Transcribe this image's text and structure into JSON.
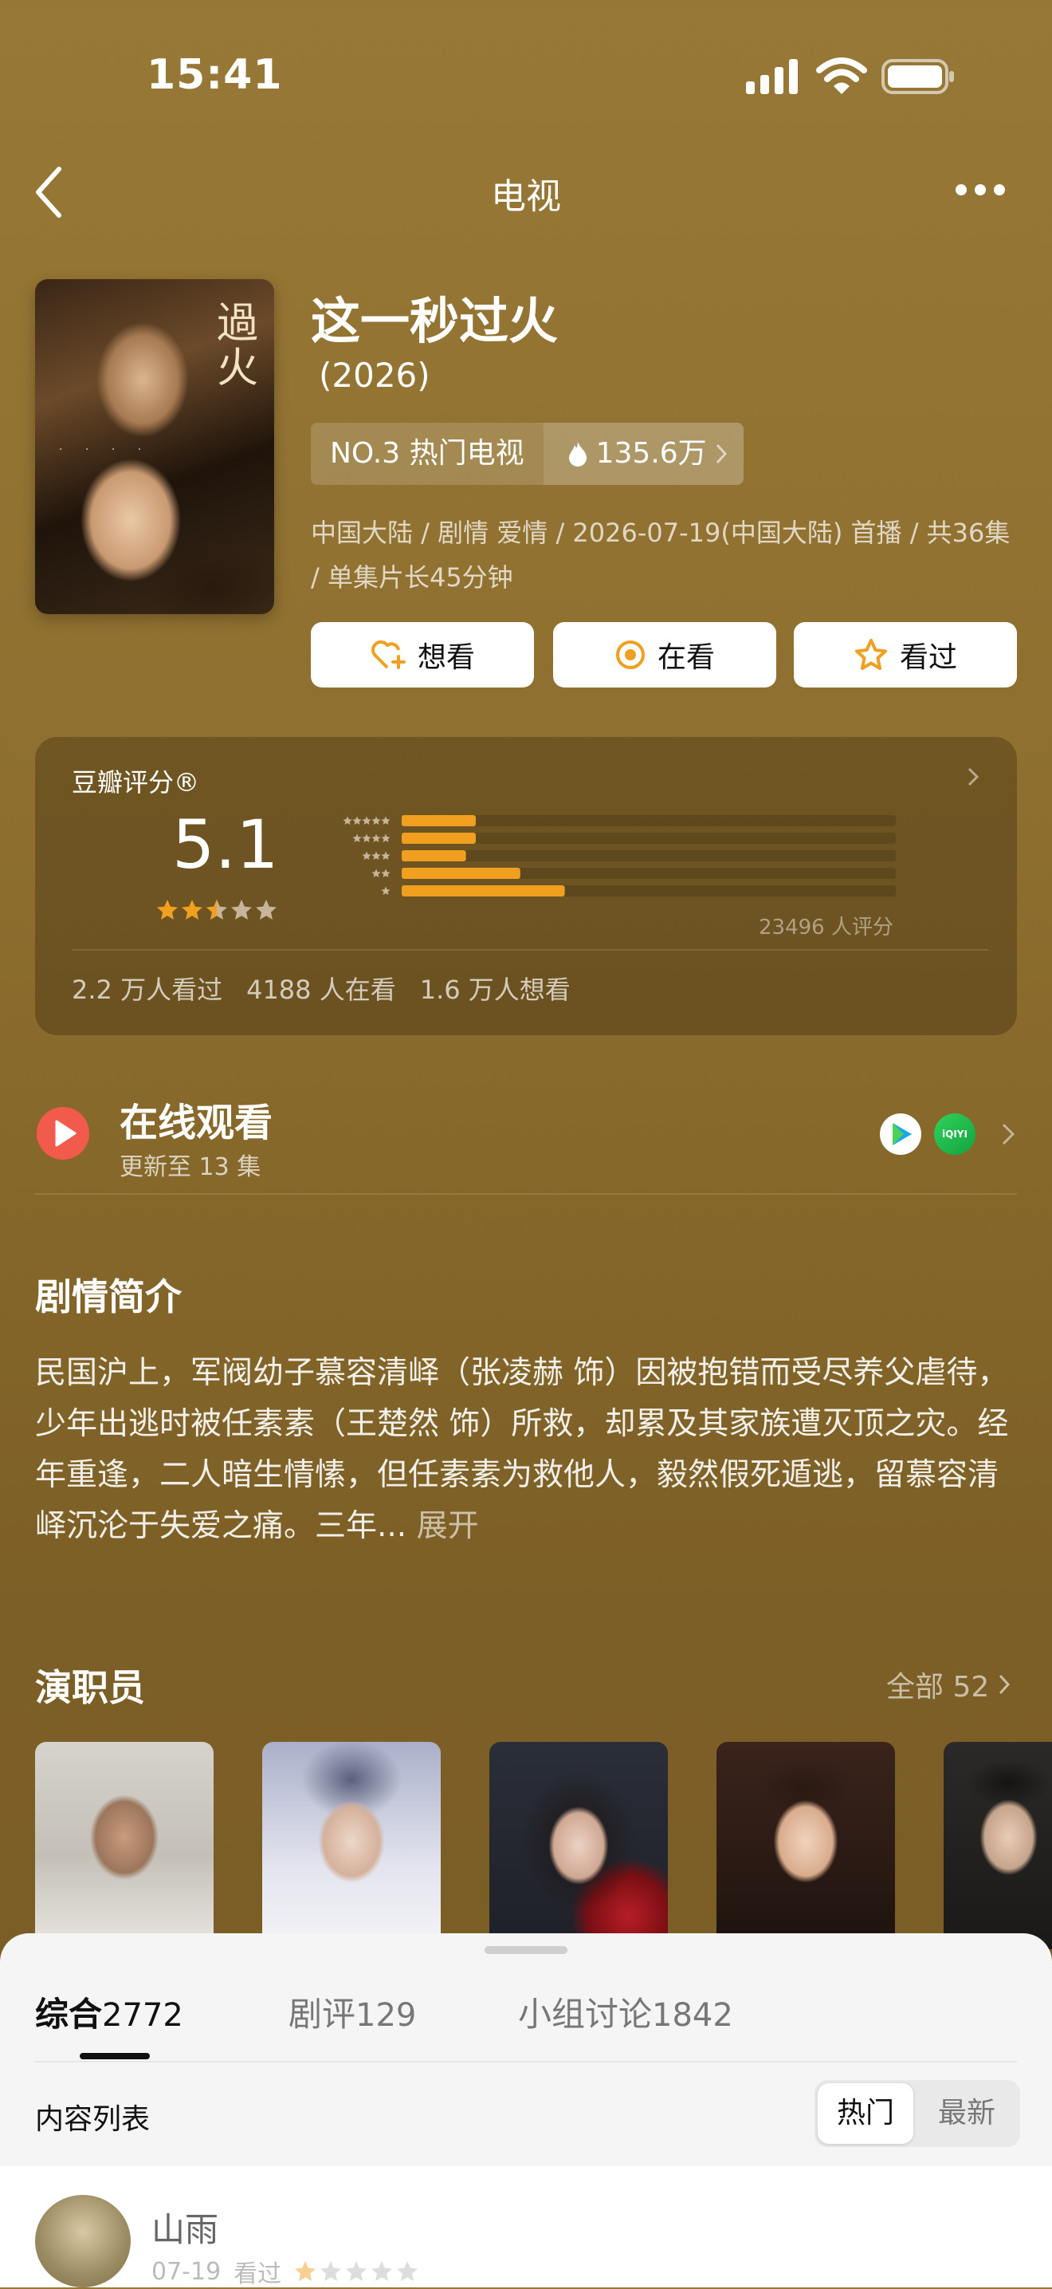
{
  "status": {
    "time": "15:41"
  },
  "nav": {
    "title": "电视"
  },
  "show": {
    "title": "这一秒过火",
    "year": "(2026)",
    "poster_title": "過火",
    "rank": "NO.3 热门电视",
    "heat": "135.6万",
    "meta": "中国大陆 / 剧情 爱情 / 2026-07-19(中国大陆) 首播 / 共36集 / 单集片长45分钟"
  },
  "actions": {
    "want": "想看",
    "watching": "在看",
    "watched": "看过"
  },
  "rating": {
    "label": "豆瓣评分®",
    "score": "5.1",
    "stars": 2.5,
    "distribution": [
      15,
      15,
      13,
      24,
      33
    ],
    "count_text": "23496 人评分",
    "watched": "2.2 万人看过",
    "watching": "4188 人在看",
    "want": "1.6 万人想看"
  },
  "online": {
    "title": "在线观看",
    "subtitle": "更新至 13 集",
    "platform2": "iQIYI"
  },
  "synopsis": {
    "title": "剧情简介",
    "text": "民国沪上，军阀幼子慕容清峄（张凌赫 饰）因被抱错而受尽养父虐待，少年出逃时被任素素（王楚然 饰）所救，却累及其家族遭灭顶之灾。经年重逢，二人暗生情愫，但任素素为救他人，毅然假死遁逃，留慕容清峄沉沦于失爱之痛。三年...",
    "expand": "展开"
  },
  "cast": {
    "title": "演职员",
    "all": "全部 52"
  },
  "tabs": [
    {
      "label": "综合",
      "count": "2772"
    },
    {
      "label": "剧评",
      "count": "129"
    },
    {
      "label": "小组讨论",
      "count": "1842"
    }
  ],
  "list": {
    "label": "内容列表",
    "hot": "热门",
    "latest": "最新"
  },
  "review": {
    "user": "山雨",
    "date": "07-19",
    "status": "看过"
  },
  "colors": {
    "accent": "#f0a01e",
    "background": "#8e6f2f"
  }
}
